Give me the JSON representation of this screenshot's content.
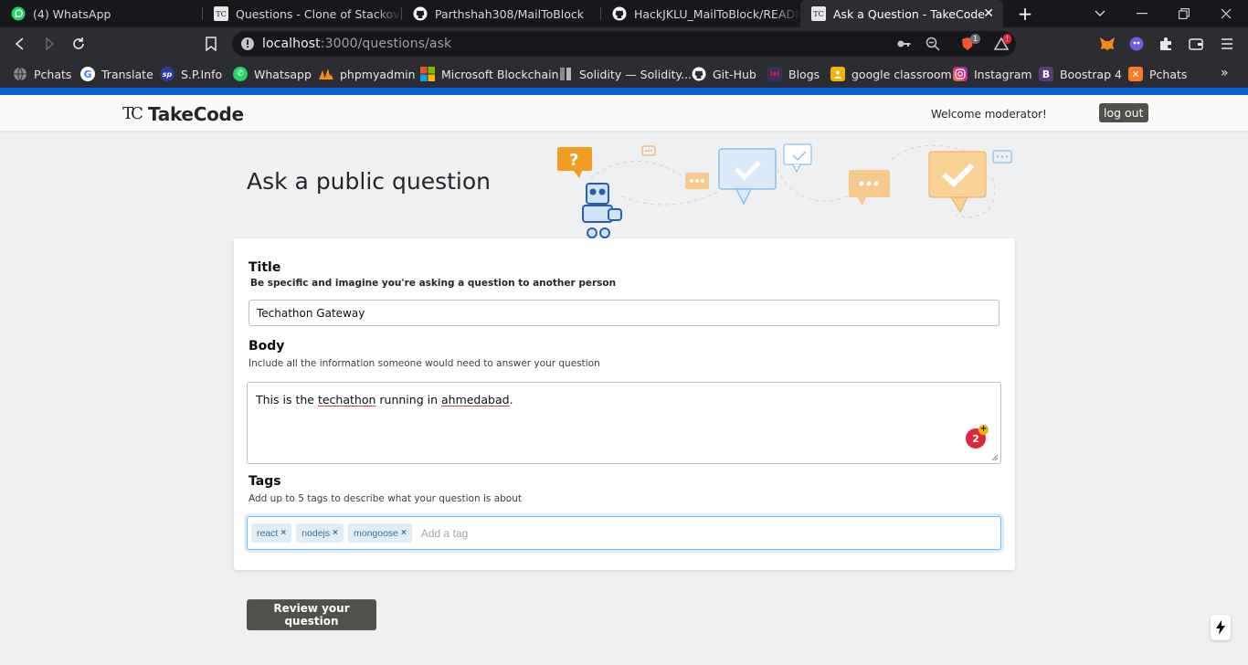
{
  "browser": {
    "tabs": [
      {
        "title": "(4) WhatsApp",
        "icon": "whatsapp-icon",
        "active": false
      },
      {
        "title": "Questions - Clone of Stackoverflow",
        "icon": "takecode-icon",
        "active": false
      },
      {
        "title": "Parthshah308/MailToBlock",
        "icon": "github-icon",
        "active": false
      },
      {
        "title": "HackJKLU_MailToBlock/README.m",
        "icon": "github-icon",
        "active": false
      },
      {
        "title": "Ask a Question - TakeCode",
        "icon": "takecode-icon",
        "active": true
      }
    ],
    "url_host": "localhost",
    "url_path": ":3000/questions/ask",
    "shield_count": "1",
    "alert_count": "!",
    "bookmarks": [
      {
        "label": "Pchats",
        "icon": "globe-icon",
        "color": "#8a8c91"
      },
      {
        "label": "Translate",
        "icon": "google-icon",
        "color": "#ffffff"
      },
      {
        "label": "S.P.Info",
        "icon": "sp-info-icon",
        "color": "#2b3b9c"
      },
      {
        "label": "Whatsapp",
        "icon": "whatsapp-icon",
        "color": "#25d366"
      },
      {
        "label": "phpmyadmin",
        "icon": "phpmyadmin-icon",
        "color": "#f29111"
      },
      {
        "label": "Microsoft Blockchain",
        "icon": "microsoft-icon",
        "color": "#f25022"
      },
      {
        "label": "Solidity — Solidity...",
        "icon": "solidity-icon",
        "color": "#8a8c91"
      },
      {
        "label": "Git-Hub",
        "icon": "github-icon",
        "color": "#ffffff"
      },
      {
        "label": "Blogs",
        "icon": "blogs-icon",
        "color": "#5a4a8c"
      },
      {
        "label": "google classroom",
        "icon": "classroom-icon",
        "color": "#f4b400"
      },
      {
        "label": "Instagram",
        "icon": "instagram-icon",
        "color": "#d6249f"
      },
      {
        "label": "Boostrap 4",
        "icon": "bootstrap-icon",
        "color": "#563d7c"
      },
      {
        "label": "Pchats",
        "icon": "xampp-icon",
        "color": "#fb7a24"
      }
    ]
  },
  "site": {
    "logo_mark": "TC",
    "logo_text": "TakeCode",
    "welcome": "Welcome moderator!",
    "logout_label": "log out"
  },
  "page": {
    "title": "Ask a public question",
    "form": {
      "title_label": "Title",
      "title_desc": "Be specific and imagine you're asking a question to another person",
      "title_value": "Techathon Gateway",
      "body_label": "Body",
      "body_desc": "Include all the information someone would need to answer your question",
      "body_value": {
        "pre": "This is the ",
        "w1": "techathon",
        "mid": " running in ",
        "w2": "ahmedabad",
        "post": "."
      },
      "grammar_count": "2",
      "tags_label": "Tags",
      "tags_desc": "Add up to 5 tags to describe what your question is about",
      "tags": [
        "react",
        "nodejs",
        "mongoose"
      ],
      "tag_remove_glyph": "×",
      "tag_placeholder": "Add a tag"
    },
    "review_label": "Review your question"
  },
  "colors": {
    "accent_bar": "#0a5ed7",
    "button_dark": "#52504b",
    "tag_bg": "#e1ecf4",
    "tag_text": "#39739d"
  }
}
